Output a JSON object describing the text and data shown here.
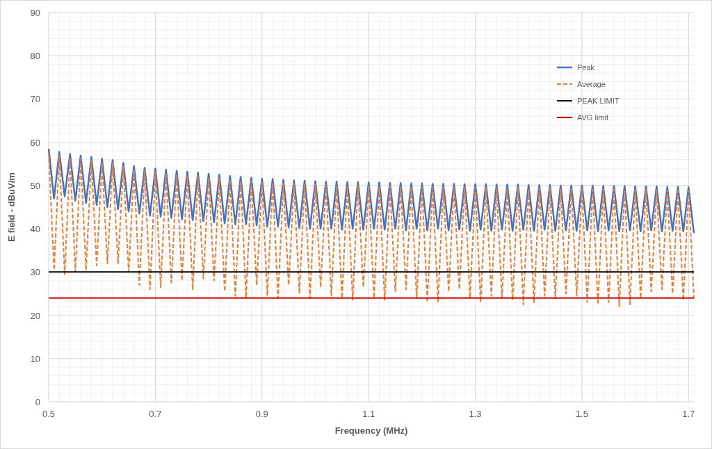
{
  "chart": {
    "chart_data": {
      "type": "line",
      "xlabel": "Frequency (MHz)",
      "ylabel": "E field - dBuV/m",
      "x": [
        0.5,
        0.51,
        0.52,
        0.53,
        0.54,
        0.55,
        0.56,
        0.57,
        0.58,
        0.59,
        0.6,
        0.61,
        0.62,
        0.63,
        0.64,
        0.65,
        0.66,
        0.67,
        0.68,
        0.69,
        0.7,
        0.71,
        0.72,
        0.73,
        0.74,
        0.75,
        0.76,
        0.77,
        0.78,
        0.79,
        0.8,
        0.81,
        0.82,
        0.83,
        0.84,
        0.85,
        0.86,
        0.87,
        0.88,
        0.89,
        0.9,
        0.91,
        0.92,
        0.93,
        0.94,
        0.95,
        0.96,
        0.97,
        0.98,
        0.99,
        1.0,
        1.01,
        1.02,
        1.03,
        1.04,
        1.05,
        1.06,
        1.07,
        1.08,
        1.09,
        1.1,
        1.11,
        1.12,
        1.13,
        1.14,
        1.15,
        1.16,
        1.17,
        1.18,
        1.19,
        1.2,
        1.21,
        1.22,
        1.23,
        1.24,
        1.25,
        1.26,
        1.27,
        1.28,
        1.29,
        1.3,
        1.31,
        1.32,
        1.33,
        1.34,
        1.35,
        1.36,
        1.37,
        1.38,
        1.39,
        1.4,
        1.41,
        1.42,
        1.43,
        1.44,
        1.45,
        1.46,
        1.47,
        1.48,
        1.49,
        1.5,
        1.51,
        1.52,
        1.53,
        1.54,
        1.55,
        1.56,
        1.57,
        1.58,
        1.59,
        1.6,
        1.61,
        1.62,
        1.63,
        1.64,
        1.65,
        1.66,
        1.67,
        1.68,
        1.69,
        1.7,
        1.71
      ],
      "series": [
        {
          "name": "Peak",
          "color": "#4472c4",
          "line_style": "solid",
          "values": [
            58.5,
            47.0,
            57.8,
            47.5,
            57.3,
            46.5,
            56.9,
            46.0,
            56.6,
            45.5,
            56.2,
            45.0,
            55.9,
            44.5,
            55.2,
            44.0,
            54.5,
            43.5,
            54.1,
            43.0,
            53.9,
            42.8,
            53.7,
            42.5,
            53.4,
            42.2,
            53.2,
            42.0,
            53.0,
            41.8,
            52.7,
            41.5,
            52.5,
            41.2,
            52.2,
            41.0,
            52.0,
            41.0,
            51.8,
            40.8,
            51.6,
            40.5,
            51.5,
            40.5,
            51.3,
            40.3,
            51.2,
            40.2,
            51.1,
            40.0,
            51.0,
            40.0,
            50.9,
            40.0,
            50.9,
            39.8,
            50.8,
            40.0,
            50.8,
            39.8,
            50.7,
            40.0,
            50.7,
            39.8,
            50.6,
            40.0,
            50.6,
            39.6,
            50.5,
            40.0,
            50.5,
            39.6,
            50.4,
            40.0,
            50.4,
            39.6,
            50.4,
            39.8,
            50.3,
            39.5,
            50.3,
            39.8,
            50.3,
            39.5,
            50.2,
            39.8,
            50.2,
            39.5,
            50.2,
            39.8,
            50.1,
            39.5,
            50.1,
            39.8,
            50.1,
            39.5,
            50.0,
            39.6,
            50.0,
            39.5,
            50.0,
            39.6,
            50.0,
            39.4,
            49.9,
            39.6,
            49.9,
            39.4,
            49.9,
            39.6,
            49.8,
            39.4,
            49.8,
            39.6,
            49.8,
            39.4,
            49.7,
            39.5,
            49.7,
            39.4,
            49.6,
            39.0
          ]
        },
        {
          "name": "Average",
          "color": "#ed7d31",
          "line_style": "dashed",
          "values": [
            57.7,
            30.5,
            57.0,
            29.5,
            56.5,
            30.0,
            56.1,
            30.5,
            55.8,
            31.5,
            55.4,
            32.0,
            55.1,
            32.0,
            54.4,
            30.0,
            53.7,
            27.0,
            53.3,
            26.0,
            53.1,
            26.5,
            52.9,
            27.5,
            52.6,
            28.0,
            52.4,
            26.0,
            52.2,
            28.5,
            51.9,
            28.0,
            51.7,
            25.5,
            51.4,
            24.5,
            51.2,
            24.0,
            51.0,
            27.0,
            50.8,
            24.5,
            50.7,
            24.0,
            50.5,
            27.0,
            50.4,
            25.0,
            50.3,
            24.0,
            50.2,
            26.5,
            50.1,
            24.5,
            50.1,
            24.0,
            50.0,
            23.5,
            50.0,
            26.5,
            49.9,
            24.0,
            49.9,
            23.5,
            49.8,
            25.5,
            49.8,
            26.0,
            49.7,
            24.0,
            49.7,
            23.0,
            49.6,
            23.0,
            49.6,
            25.5,
            49.6,
            26.0,
            49.5,
            24.0,
            49.5,
            23.0,
            49.5,
            24.5,
            49.4,
            24.0,
            49.4,
            23.5,
            49.4,
            22.5,
            49.3,
            23.0,
            49.3,
            24.5,
            49.3,
            24.0,
            49.2,
            25.0,
            49.2,
            24.5,
            49.2,
            23.0,
            49.1,
            22.5,
            49.1,
            23.0,
            49.1,
            22.0,
            49.0,
            22.5,
            49.0,
            24.0,
            49.0,
            25.5,
            48.9,
            26.0,
            48.9,
            25.0,
            48.8,
            23.5,
            48.8,
            24.0
          ]
        },
        {
          "name": "PEAK LIMIT",
          "color": "#000000",
          "line_style": "solid",
          "values": [
            30,
            30,
            30,
            30,
            30,
            30,
            30,
            30,
            30,
            30,
            30,
            30,
            30,
            30,
            30,
            30,
            30,
            30,
            30,
            30,
            30,
            30,
            30,
            30,
            30,
            30,
            30,
            30,
            30,
            30,
            30,
            30,
            30,
            30,
            30,
            30,
            30,
            30,
            30,
            30,
            30,
            30,
            30,
            30,
            30,
            30,
            30,
            30,
            30,
            30,
            30,
            30,
            30,
            30,
            30,
            30,
            30,
            30,
            30,
            30,
            30,
            30,
            30,
            30,
            30,
            30,
            30,
            30,
            30,
            30,
            30,
            30,
            30,
            30,
            30,
            30,
            30,
            30,
            30,
            30,
            30,
            30,
            30,
            30,
            30,
            30,
            30,
            30,
            30,
            30,
            30,
            30,
            30,
            30,
            30,
            30,
            30,
            30,
            30,
            30,
            30,
            30,
            30,
            30,
            30,
            30,
            30,
            30,
            30,
            30,
            30,
            30,
            30,
            30,
            30,
            30,
            30,
            30,
            30,
            30,
            30,
            30
          ]
        },
        {
          "name": "AVG limit",
          "color": "#e00000",
          "line_style": "solid",
          "values": [
            24,
            24,
            24,
            24,
            24,
            24,
            24,
            24,
            24,
            24,
            24,
            24,
            24,
            24,
            24,
            24,
            24,
            24,
            24,
            24,
            24,
            24,
            24,
            24,
            24,
            24,
            24,
            24,
            24,
            24,
            24,
            24,
            24,
            24,
            24,
            24,
            24,
            24,
            24,
            24,
            24,
            24,
            24,
            24,
            24,
            24,
            24,
            24,
            24,
            24,
            24,
            24,
            24,
            24,
            24,
            24,
            24,
            24,
            24,
            24,
            24,
            24,
            24,
            24,
            24,
            24,
            24,
            24,
            24,
            24,
            24,
            24,
            24,
            24,
            24,
            24,
            24,
            24,
            24,
            24,
            24,
            24,
            24,
            24,
            24,
            24,
            24,
            24,
            24,
            24,
            24,
            24,
            24,
            24,
            24,
            24,
            24,
            24,
            24,
            24,
            24,
            24,
            24,
            24,
            24,
            24,
            24,
            24,
            24,
            24,
            24,
            24,
            24,
            24,
            24,
            24,
            24,
            24,
            24,
            24,
            24,
            24
          ]
        }
      ],
      "xlim": [
        0.5,
        1.71
      ],
      "ylim": [
        0,
        90
      ],
      "grid": true,
      "legend": "top-right",
      "xticks": [
        {
          "value": 0.5,
          "label": "0.5"
        },
        {
          "value": 0.7,
          "label": "0.7"
        },
        {
          "value": 0.9,
          "label": "0.9"
        },
        {
          "value": 1.1,
          "label": "1.1"
        },
        {
          "value": 1.3,
          "label": "1.3"
        },
        {
          "value": 1.5,
          "label": "1.5"
        },
        {
          "value": 1.7,
          "label": "1.7"
        }
      ],
      "yticks": [
        0,
        10,
        20,
        30,
        40,
        50,
        60,
        70,
        80,
        90
      ]
    }
  }
}
